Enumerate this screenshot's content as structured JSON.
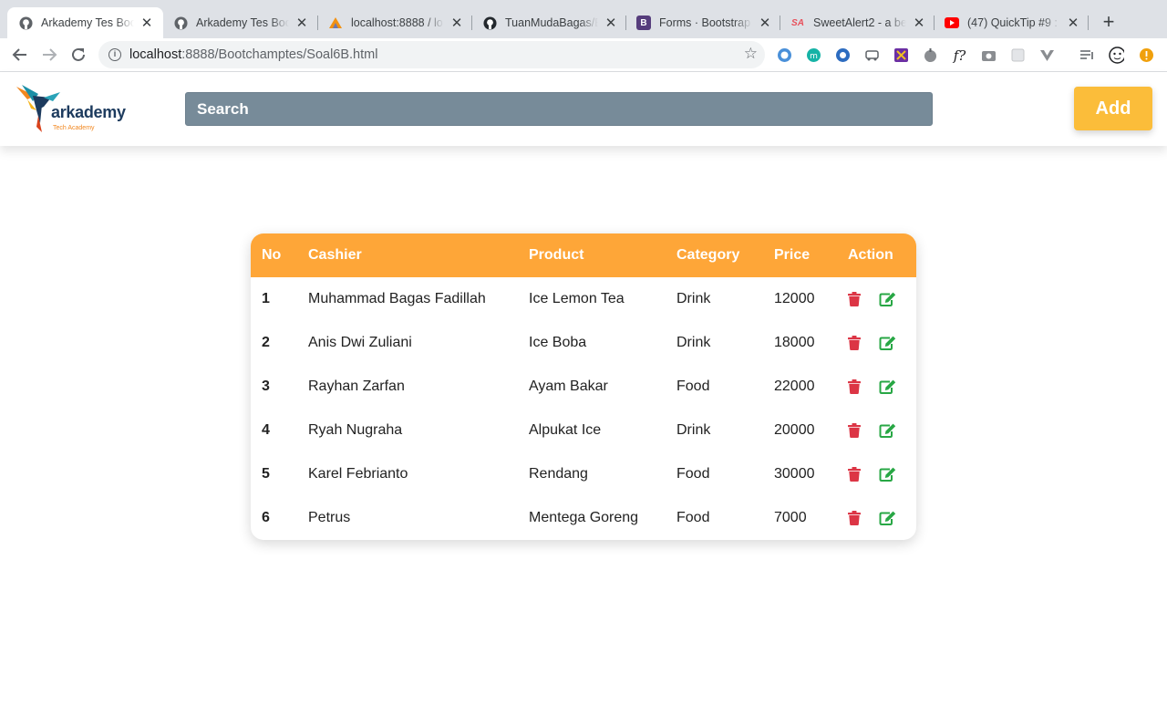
{
  "browser": {
    "tabs": [
      {
        "title": "Arkademy Tes Boo",
        "favicon": "github-icon",
        "active": true
      },
      {
        "title": "Arkademy Tes Boo",
        "favicon": "github-icon",
        "active": false
      },
      {
        "title": "localhost:8888 / lo",
        "favicon": "phpmyadmin-icon",
        "active": false
      },
      {
        "title": "TuanMudaBagas/B",
        "favicon": "github-icon",
        "active": false
      },
      {
        "title": "Forms · Bootstrap",
        "favicon": "bootstrap-icon",
        "active": false
      },
      {
        "title": "SweetAlert2 - a be",
        "favicon": "sweetalert-icon",
        "active": false
      },
      {
        "title": "(47) QuickTip #9 :",
        "favicon": "youtube-icon",
        "active": false
      }
    ],
    "url_host": "localhost",
    "url_path": ":8888/Bootchamptes/Soal6B.html"
  },
  "header": {
    "logo_text": "arkademy",
    "logo_subtext": "Tech Academy",
    "search_placeholder": "Search",
    "add_label": "Add"
  },
  "table": {
    "columns": [
      "No",
      "Cashier",
      "Product",
      "Category",
      "Price",
      "Action"
    ],
    "rows": [
      {
        "no": "1",
        "cashier": "Muhammad Bagas Fadillah",
        "product": "Ice Lemon Tea",
        "category": "Drink",
        "price": "12000"
      },
      {
        "no": "2",
        "cashier": "Anis Dwi Zuliani",
        "product": "Ice Boba",
        "category": "Drink",
        "price": "18000"
      },
      {
        "no": "3",
        "cashier": "Rayhan Zarfan",
        "product": "Ayam Bakar",
        "category": "Food",
        "price": "22000"
      },
      {
        "no": "4",
        "cashier": "Ryah Nugraha",
        "product": "Alpukat Ice",
        "category": "Drink",
        "price": "20000"
      },
      {
        "no": "5",
        "cashier": "Karel Febrianto",
        "product": "Rendang",
        "category": "Food",
        "price": "30000"
      },
      {
        "no": "6",
        "cashier": "Petrus",
        "product": "Mentega Goreng",
        "category": "Food",
        "price": "7000"
      }
    ]
  },
  "colors": {
    "header_orange": "#fea638",
    "add_button": "#fbbd3a",
    "search_bg": "#778b99",
    "delete_red": "#dc3545",
    "edit_green": "#28a745"
  }
}
